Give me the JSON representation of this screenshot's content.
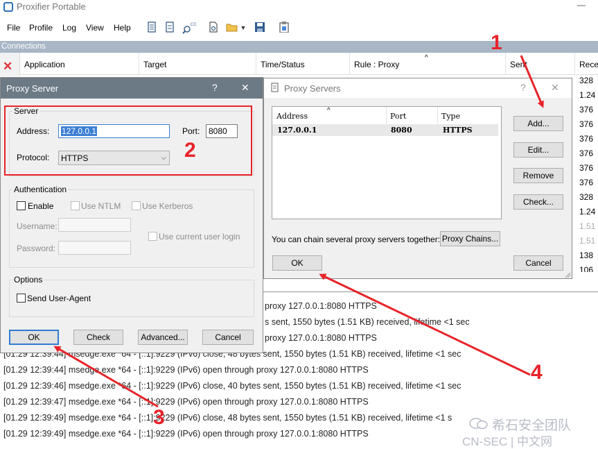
{
  "window": {
    "title": "Proxifier Portable",
    "minimize_glyph": "—"
  },
  "menu": [
    "File",
    "Profile",
    "Log",
    "View",
    "Help"
  ],
  "toolbar_icons": [
    "connections-icon",
    "statistics-icon",
    "dns-icon",
    "new-profile-icon",
    "open-profile-icon",
    "dropdown-icon",
    "save-icon",
    "clipboard-icon"
  ],
  "connections": {
    "section_label": "Connections",
    "columns": [
      "Application",
      "Target",
      "Time/Status",
      "Rule : Proxy",
      "Sent",
      "Recei"
    ],
    "sort_glyph": "^",
    "received_values": [
      "328",
      "1.24",
      "376",
      "376",
      "376",
      "376",
      "376",
      "376",
      "328",
      "1.24",
      "1.51",
      "1.51",
      "138",
      "106"
    ]
  },
  "log_lines": [
    "proxy 127.0.0.1:8080 HTTPS",
    "s sent, 1550 bytes (1.51 KB) received, lifetime <1 sec",
    "proxy 127.0.0.1:8080 HTTPS",
    "[01.29 12:39:44] msedge.exe *64 - [::1]:9229 (IPv6) close, 48 bytes sent, 1550 bytes (1.51 KB) received, lifetime <1 sec",
    "[01.29 12:39:44] msedge.exe *64 - [::1]:9229 (IPv6) open through proxy 127.0.0.1:8080 HTTPS",
    "[01.29 12:39:46] msedge.exe *64 - [::1]:9229 (IPv6) close, 40 bytes sent, 1550 bytes (1.51 KB) received, lifetime <1 sec",
    "[01.29 12:39:47] msedge.exe *64 - [::1]:9229 (IPv6) open through proxy 127.0.0.1:8080 HTTPS",
    "[01.29 12:39:49] msedge.exe *64 - [::1]:9229 (IPv6) close, 48 bytes sent, 1550 bytes (1.51 KB) received, lifetime <1 s",
    "[01.29 12:39:49] msedge.exe *64 - [::1]:9229 (IPv6) open through proxy 127.0.0.1:8080 HTTPS"
  ],
  "proxy_server_dialog": {
    "title": "Proxy Server",
    "help_glyph": "?",
    "close_glyph": "✕",
    "server_group": "Server",
    "address_label": "Address:",
    "address_value": "127.0.0.1",
    "port_label": "Port:",
    "port_value": "8080",
    "protocol_label": "Protocol:",
    "protocol_value": "HTTPS",
    "auth_group": "Authentication",
    "enable_label": "Enable",
    "use_ntlm_label": "Use NTLM",
    "use_kerberos_label": "Use Kerberos",
    "username_label": "Username:",
    "password_label": "Password:",
    "use_current_login_label": "Use current user login",
    "options_group": "Options",
    "send_user_agent_label": "Send User-Agent",
    "ok_label": "OK",
    "check_label": "Check",
    "advanced_label": "Advanced...",
    "cancel_label": "Cancel"
  },
  "proxy_servers_dialog": {
    "title": "Proxy Servers",
    "help_glyph": "?",
    "close_glyph": "✕",
    "columns": [
      "Address",
      "Port",
      "Type"
    ],
    "sort_glyph": "^",
    "rows": [
      {
        "address": "127.0.0.1",
        "port": "8080",
        "type": "HTTPS"
      }
    ],
    "add_label": "Add...",
    "edit_label": "Edit...",
    "remove_label": "Remove",
    "check_label": "Check...",
    "chain_text": "You can chain several proxy servers together:",
    "proxy_chains_label": "Proxy Chains...",
    "ok_label": "OK",
    "cancel_label": "Cancel"
  },
  "annotations": {
    "n1": "1",
    "n2": "2",
    "n3": "3",
    "n4": "4",
    "color": "#e8232a"
  },
  "watermark": {
    "account": "希石安全团队",
    "site": "CN-SEC | 中文网"
  }
}
